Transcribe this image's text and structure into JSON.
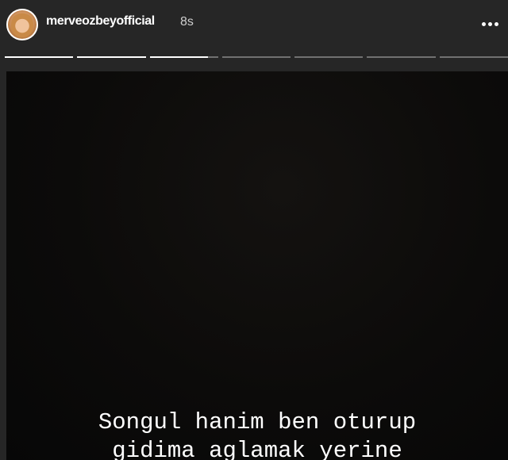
{
  "header": {
    "username": "merveozbeyofficial",
    "timestamp": "8s",
    "avatar_icon": "profile-avatar",
    "more_icon": "more-horizontal-icon"
  },
  "progress": {
    "segments": [
      1,
      1,
      0.85,
      0,
      0,
      0,
      0
    ]
  },
  "story": {
    "text_line_1": "Songul hanim ben oturup",
    "text_line_2": "gidima aglamak yerine"
  },
  "colors": {
    "background": "#262626",
    "story_background": "#0c0b0a",
    "text": "#ffffff"
  }
}
